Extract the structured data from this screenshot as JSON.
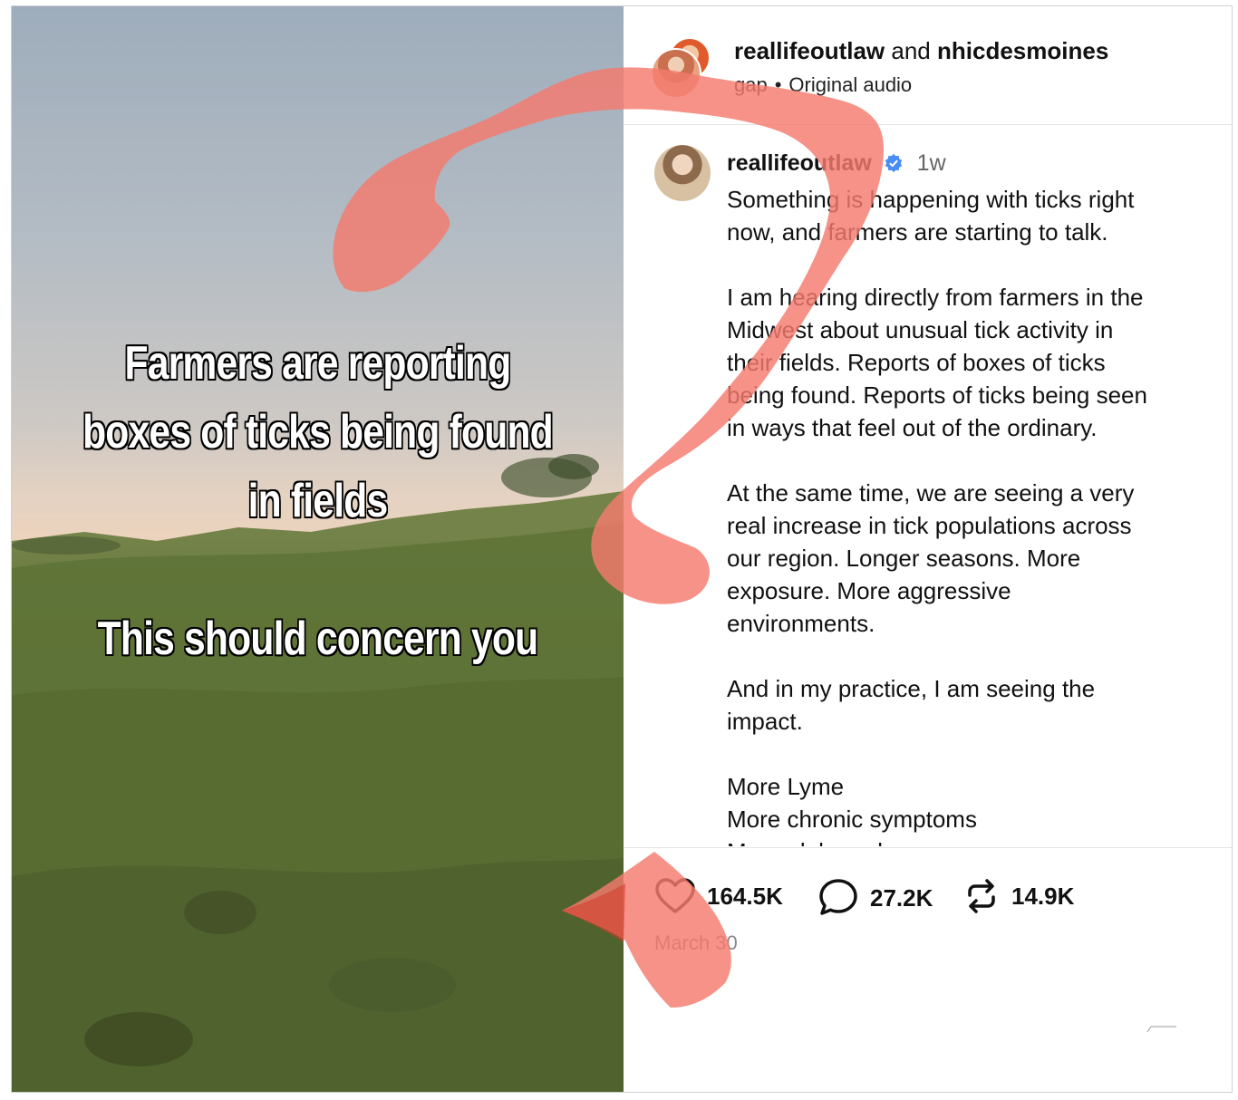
{
  "video": {
    "caption_top": [
      "Farmers are reporting",
      "boxes of ticks being found",
      "in fields"
    ],
    "caption_bottom": "This should concern you"
  },
  "header": {
    "user1": "reallifeoutlaw",
    "and": "and",
    "user2": "nhicdesmoines",
    "audio_artist": "gap",
    "separator": "•",
    "audio_title": "Original audio"
  },
  "post": {
    "username": "reallifeoutlaw",
    "time": "1w",
    "paragraphs": [
      [
        "Something is happening with ticks right",
        "now, and farmers are starting to talk."
      ],
      [
        "I am hearing directly from farmers in the",
        "Midwest about unusual tick activity in",
        "their fields. Reports of boxes of ticks",
        "being found. Reports of ticks being seen",
        "in ways that feel out of the ordinary."
      ],
      [
        "At the same time, we are seeing a very",
        "real increase in tick populations across",
        "our region. Longer seasons. More",
        "exposure. More aggressive",
        "environments."
      ],
      [
        "And in my practice, I am seeing the",
        "impact."
      ],
      [
        "More Lyme",
        "More chronic symptoms",
        "More alpha gal"
      ]
    ]
  },
  "actions": {
    "likes": "164.5K",
    "comments": "27.2K",
    "reposts": "14.9K",
    "date": "March 30"
  },
  "colors": {
    "overlay_mark": "#f47a6e",
    "verified": "#4a8cf7"
  },
  "icons": [
    "heart-icon",
    "comment-icon",
    "repost-icon",
    "verified-icon"
  ]
}
